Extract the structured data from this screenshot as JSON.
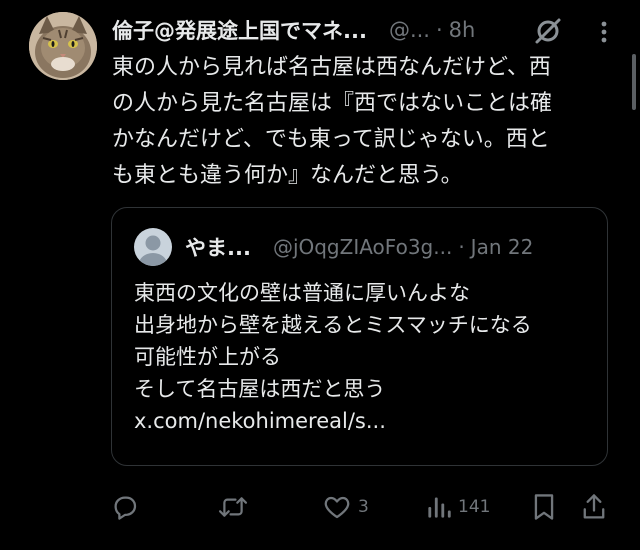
{
  "tweet": {
    "display_name": "倫子@発展途上国でマネ...",
    "handle": "@...",
    "separator": "·",
    "time": "8h",
    "text": "東の人から見れば名古屋は西なんだけど、西\nの人から見た名古屋は『西ではないことは確\nかなんだけど、でも東って訳じゃない。西と\nも東とも違う何か』なんだと思う。"
  },
  "quote": {
    "display_name": "やま...",
    "handle": "@jOqgZIAoFo3g...",
    "separator": "·",
    "date": "Jan 22",
    "text": "東西の文化の壁は普通に厚いんよな\n出身地から壁を越えるとミスマッチになる\n可能性が上がる\nそして名古屋は西だと思う\nx.com/nekohimereal/s..."
  },
  "actions": {
    "reply_count": "",
    "retweet_count": "",
    "like_count": "3",
    "view_count": "141"
  },
  "icons": {
    "avatar": "cat-avatar",
    "grok": "grok-icon",
    "more": "more-vertical-icon",
    "quote_avatar": "default-user-avatar",
    "reply": "reply-icon",
    "retweet": "retweet-icon",
    "like": "heart-icon",
    "views": "views-icon",
    "bookmark": "bookmark-icon",
    "share": "share-icon"
  },
  "colors": {
    "background": "#000000",
    "text_primary": "#e7e9ea",
    "text_secondary": "#71767b",
    "border": "#2f3336"
  }
}
